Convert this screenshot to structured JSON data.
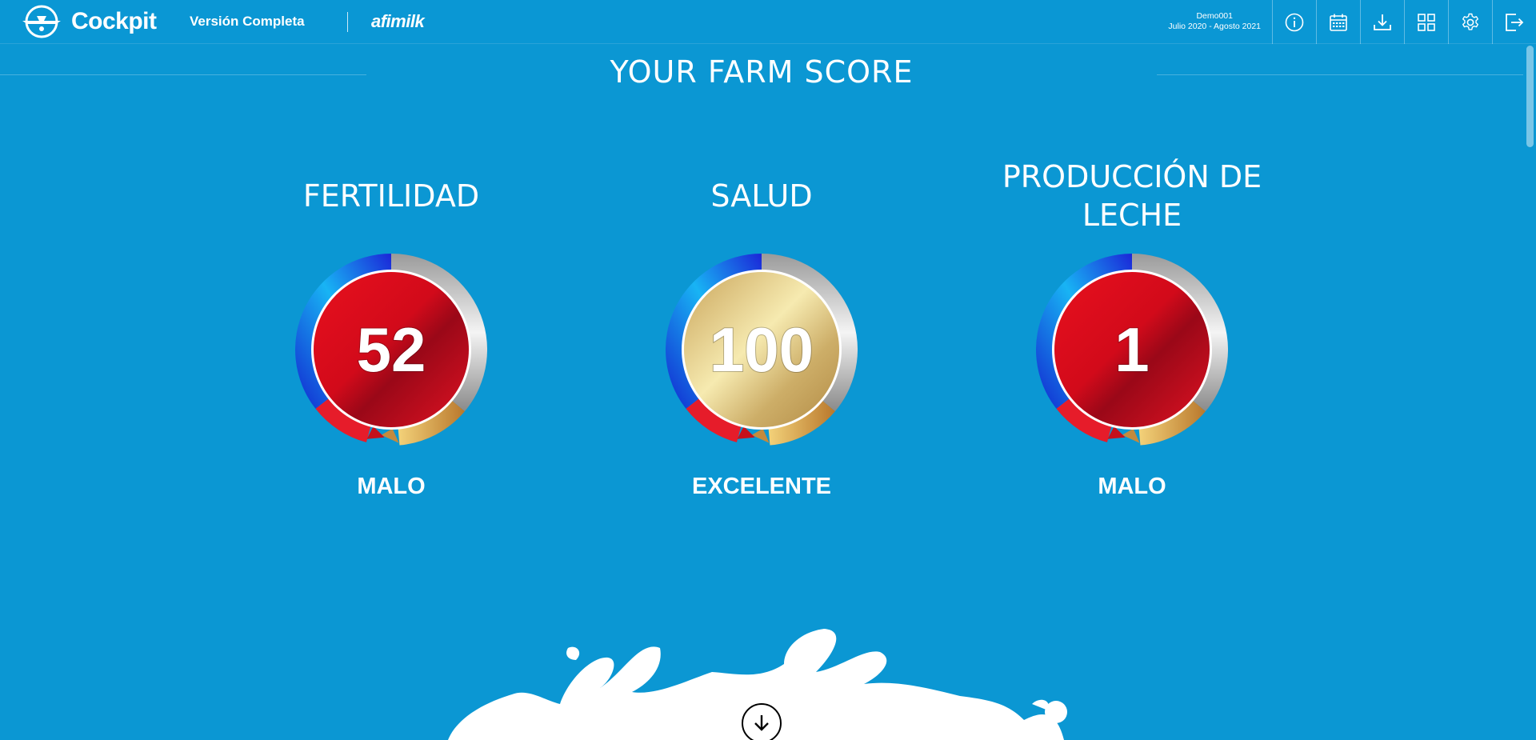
{
  "header": {
    "brand": "Cockpit",
    "version": "Versión Completa",
    "partner": "afimilk",
    "farm_name": "Demo001",
    "period": "Julio 2020 - Agosto 2021",
    "icons": [
      "info-icon",
      "calendar-icon",
      "download-icon",
      "grid-icon",
      "gear-icon",
      "logout-icon"
    ]
  },
  "page": {
    "title": "YOUR FARM SCORE"
  },
  "scores": [
    {
      "title": "FERTILIDAD",
      "value": "52",
      "status": "MALO",
      "level": "red",
      "pointer_fraction": 0.52
    },
    {
      "title": "SALUD",
      "value": "100",
      "status": "EXCELENTE",
      "level": "gold",
      "pointer_fraction": 0.94
    },
    {
      "title": "PRODUCCIÓN DE LECHE",
      "value": "1",
      "status": "MALO",
      "level": "red",
      "pointer_fraction": 0.78
    }
  ],
  "colors": {
    "background": "#0b97d3",
    "red_score": "#c0111f",
    "gold_score": "#d9c27a"
  }
}
